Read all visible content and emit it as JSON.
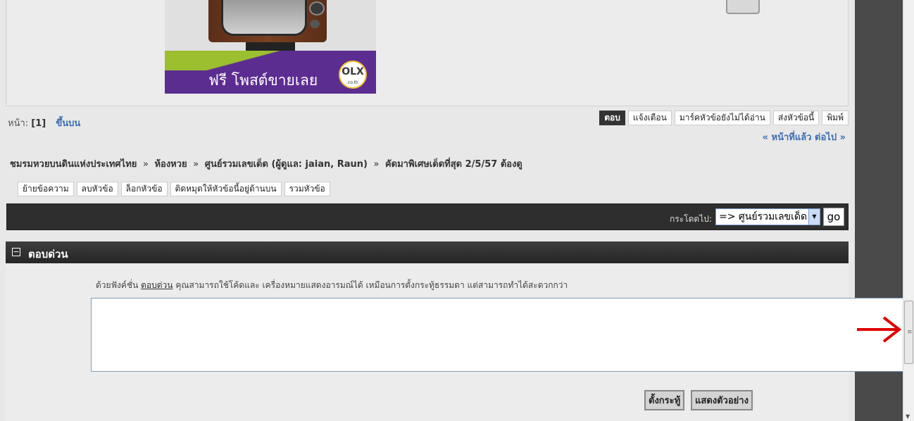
{
  "ad": {
    "text": "ฟรี โพสต์ขายเลย",
    "logo": "OLX",
    "logo_sub": ".co.th"
  },
  "pagination": {
    "label": "หน้า:",
    "current": "[1]",
    "top_link": "ขึ้นบน"
  },
  "topic_buttons": [
    "ตอบ",
    "แจ้งเตือน",
    "มาร์คหัวข้อยังไม่ได้อ่าน",
    "ส่งหัวข้อนี้",
    "พิมพ์"
  ],
  "prevnext": "« หน้าที่แล้ว ต่อไป »",
  "breadcrumb": {
    "items": [
      "ชมรมหวยบนดินแห่งประเทศไทย",
      "ห้องหวย",
      "ศูนย์รวมเลขเด็ด (ผู้ดูแล: jaian, Raun)",
      "คัดมาพิเศษเด็ดที่สุด 2/5/57 ต้องดู"
    ],
    "separator": "»"
  },
  "mod_buttons": [
    "ย้ายข้อความ",
    "ลบหัวข้อ",
    "ล็อกหัวข้อ",
    "ติดหมุดให้หัวข้อนี้อยู่ด้านบน",
    "รวมหัวข้อ"
  ],
  "jump": {
    "label": "กระโดดไป:",
    "selected": "=> ศูนย์รวมเลขเด็ด",
    "go": "go"
  },
  "quick_reply": {
    "toggle": "−",
    "title": "ตอบด่วน",
    "note_before": "ด้วยฟังค์ชั่น",
    "note_link": "ตอบด่วน",
    "note_after": "คุณสามารถใช้โค้ดและ เครื่องหมายแสดงอารมณ์ได้ เหมือนการตั้งกระทู้ธรรมดา แต่สามารถทำได้สะดวกกว่า",
    "textarea_value": "",
    "post_button": "ตั้งกระทู้",
    "preview_button": "แสดงตัวอย่าง"
  },
  "colors": {
    "link": "#3b6db3",
    "bar": "#2e2e2e",
    "annotation_arrow": "#e00000"
  },
  "icons": {
    "grip": "scrollbar-grip-icon",
    "arrow": "red-arrow-icon"
  }
}
